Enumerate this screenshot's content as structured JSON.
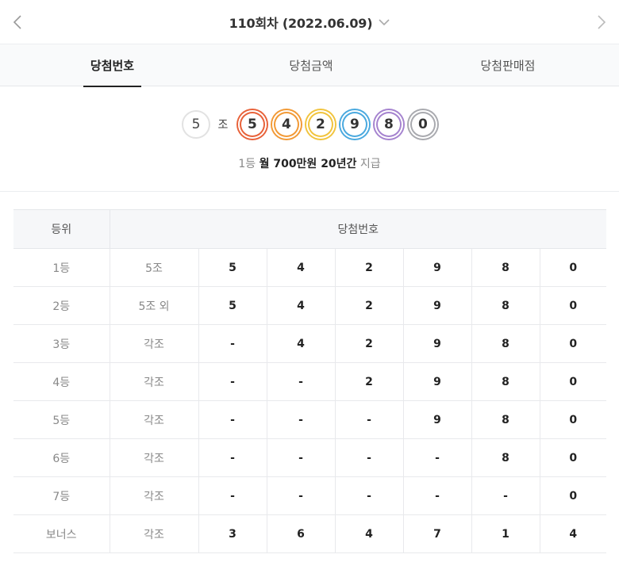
{
  "header": {
    "round_title": "110회차 (2022.06.09)",
    "prev_icon": "chevron-left-icon",
    "next_icon": "chevron-right-icon",
    "dropdown_icon": "chevron-down-icon"
  },
  "tabs": [
    {
      "label": "당첨번호",
      "active": true
    },
    {
      "label": "당첨금액",
      "active": false
    },
    {
      "label": "당첨판매점",
      "active": false
    }
  ],
  "winning": {
    "group": "5",
    "group_label": "조",
    "digits": [
      "5",
      "4",
      "2",
      "9",
      "8",
      "0"
    ],
    "digit_colors": [
      "#e8623a",
      "#f29a36",
      "#f1c43e",
      "#4aa9df",
      "#a583cf",
      "#a9aaaf"
    ]
  },
  "prize": {
    "rank": "1등",
    "amount": "월 700만원 20년간",
    "suffix": "지급"
  },
  "table": {
    "headers": {
      "rank": "등위",
      "numbers": "당첨번호"
    },
    "rows": [
      {
        "rank": "1등",
        "group": "5조",
        "digits": [
          "5",
          "4",
          "2",
          "9",
          "8",
          "0"
        ]
      },
      {
        "rank": "2등",
        "group": "5조 외",
        "digits": [
          "5",
          "4",
          "2",
          "9",
          "8",
          "0"
        ]
      },
      {
        "rank": "3등",
        "group": "각조",
        "digits": [
          "-",
          "4",
          "2",
          "9",
          "8",
          "0"
        ]
      },
      {
        "rank": "4등",
        "group": "각조",
        "digits": [
          "-",
          "-",
          "2",
          "9",
          "8",
          "0"
        ]
      },
      {
        "rank": "5등",
        "group": "각조",
        "digits": [
          "-",
          "-",
          "-",
          "9",
          "8",
          "0"
        ]
      },
      {
        "rank": "6등",
        "group": "각조",
        "digits": [
          "-",
          "-",
          "-",
          "-",
          "8",
          "0"
        ]
      },
      {
        "rank": "7등",
        "group": "각조",
        "digits": [
          "-",
          "-",
          "-",
          "-",
          "-",
          "0"
        ]
      },
      {
        "rank": "보너스",
        "group": "각조",
        "digits": [
          "3",
          "6",
          "4",
          "7",
          "1",
          "4"
        ]
      }
    ]
  }
}
